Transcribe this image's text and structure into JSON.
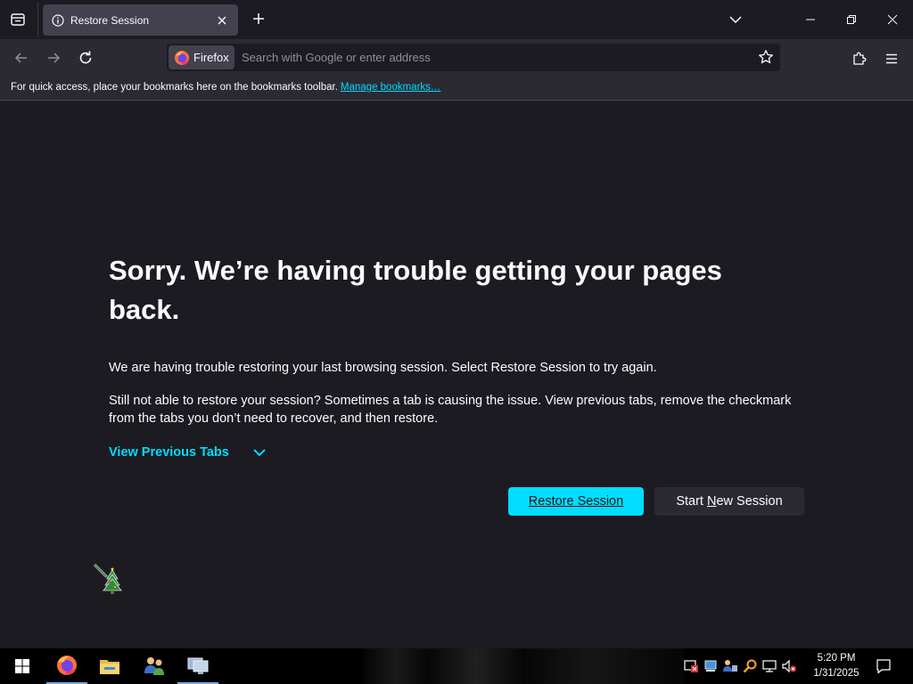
{
  "tab": {
    "title": "Restore Session"
  },
  "identity": {
    "label": "Firefox"
  },
  "urlbar": {
    "placeholder": "Search with Google or enter address",
    "value": ""
  },
  "bookmarks_bar": {
    "message": "For quick access, place your bookmarks here on the bookmarks toolbar.",
    "link": "Manage bookmarks…"
  },
  "page": {
    "headline": "Sorry. We’re having trouble getting your pages back.",
    "description1": "We are having trouble restoring your last browsing session. Select Restore Session to try again.",
    "description2": "Still not able to restore your session? Sometimes a tab is causing the issue. View previous tabs, remove the checkmark from the tabs you don’t need to recover, and then restore.",
    "view_previous_tabs": "View Previous Tabs",
    "restore_button": "Restore Session",
    "new_session_button_prefix": "Start ",
    "new_session_button_accel": "N",
    "new_session_button_suffix": "ew Session"
  },
  "taskbar": {
    "apps": [
      "firefox-icon",
      "file-explorer-icon",
      "users-icon",
      "remote-desktop-icon"
    ],
    "tray_icons": [
      "remote-security-icon",
      "network-drive-icon",
      "user-network-icon",
      "search-tray-icon",
      "display-network-icon",
      "volume-muted-icon"
    ],
    "time": "5:20 PM",
    "date": "1/31/2025"
  },
  "colors": {
    "accent": "#00ddff",
    "background": "#1c1b22",
    "toolbar": "#2b2a33",
    "tab_selected": "#42414d"
  }
}
